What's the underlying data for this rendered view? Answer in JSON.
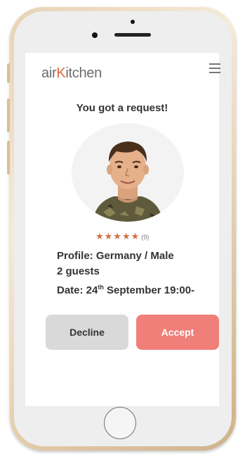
{
  "app": {
    "logo_prefix": "air",
    "logo_k": "K",
    "logo_suffix": "itchen"
  },
  "request": {
    "title": "You got a request!",
    "stars": "★★★★★",
    "review_count": "(9)",
    "profile": "Profile: Germany / Male",
    "guests": "2 guests",
    "date_prefix": "Date: 24",
    "date_sup": "th",
    "date_suffix": " September 19:00-"
  },
  "actions": {
    "decline_label": "Decline",
    "accept_label": "Accept"
  },
  "colors": {
    "accent": "#ef7f78",
    "logo_k": "#e0673f",
    "stars": "#d06f45",
    "decline_bg": "#d9d9d9"
  }
}
